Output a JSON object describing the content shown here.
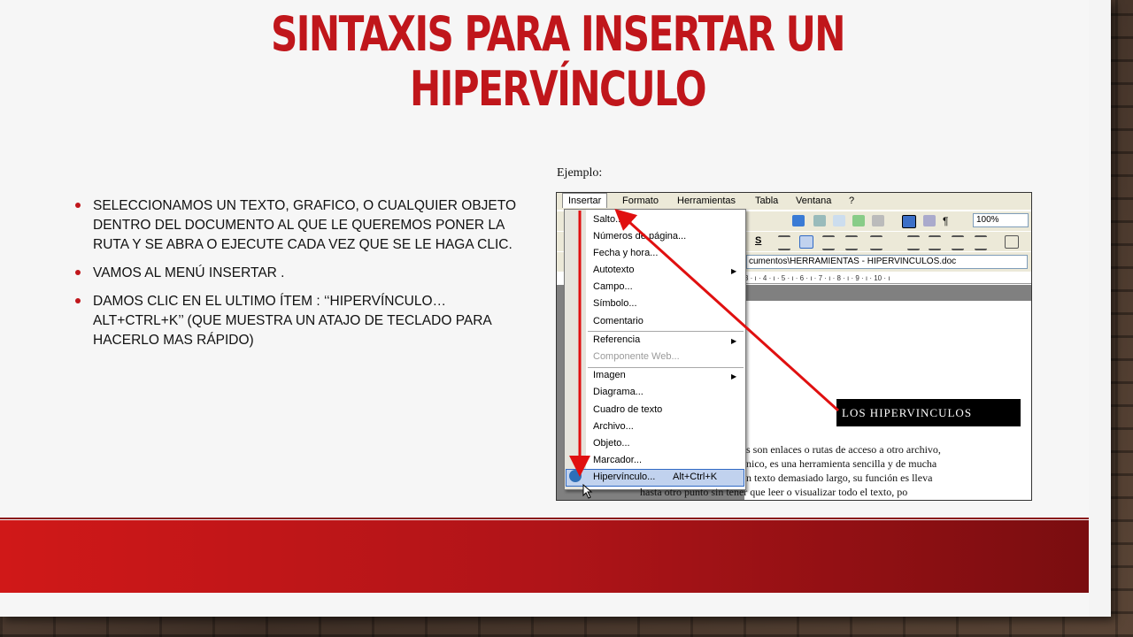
{
  "slide": {
    "title_line1": "Sintaxis para insertar un",
    "title_line2": "hipervínculo",
    "bullets": [
      "Seleccionamos un texto, grafico, o cualquier objeto dentro del documento al que le queremos poner la ruta y se abra o ejecute cada vez que se le haga clic.",
      "Vamos al menú Insertar .",
      "Damos clic en el ultimo ítem : ‘‘Hipervínculo…Alt+Ctrl+K’’ (que muestra un atajo de teclado para hacerlo mas rápido)"
    ],
    "example_label": "Ejemplo:",
    "accent_color": "#c0161b"
  },
  "word": {
    "menubar": [
      "Insertar",
      "Formato",
      "Herramientas",
      "Tabla",
      "Ventana",
      "?"
    ],
    "zoom": "100%",
    "address": "cumentos\\HERRAMIENTAS - HIPERVINCULOS.doc",
    "ruler": "3 · ı · 4 · ı · 5 · ı · 6 · ı · 7 · ı · 8 · ı · 9 · ı · 10 · ı",
    "menu_items": [
      "Salto...",
      "Números de página...",
      "Fecha y hora...",
      "Autotexto",
      "Campo...",
      "Símbolo...",
      "Comentario",
      "Referencia",
      "Componente Web...",
      "Imagen",
      "Diagrama...",
      "Cuadro de texto",
      "Archivo...",
      "Objeto...",
      "Marcador...",
      "Hipervínculo..."
    ],
    "shortcut": "Alt+Ctrl+K",
    "doc_heading": "LOS HIPERVINCULOS",
    "doc_lines": [
      "s son enlaces o rutas de acceso a otro archivo,",
      "nico, es una herramienta sencilla y de mucha",
      "n texto demasiado largo, su función es lleva",
      "hasta otro punto sin tener que leer o visualizar todo el texto, po"
    ]
  }
}
